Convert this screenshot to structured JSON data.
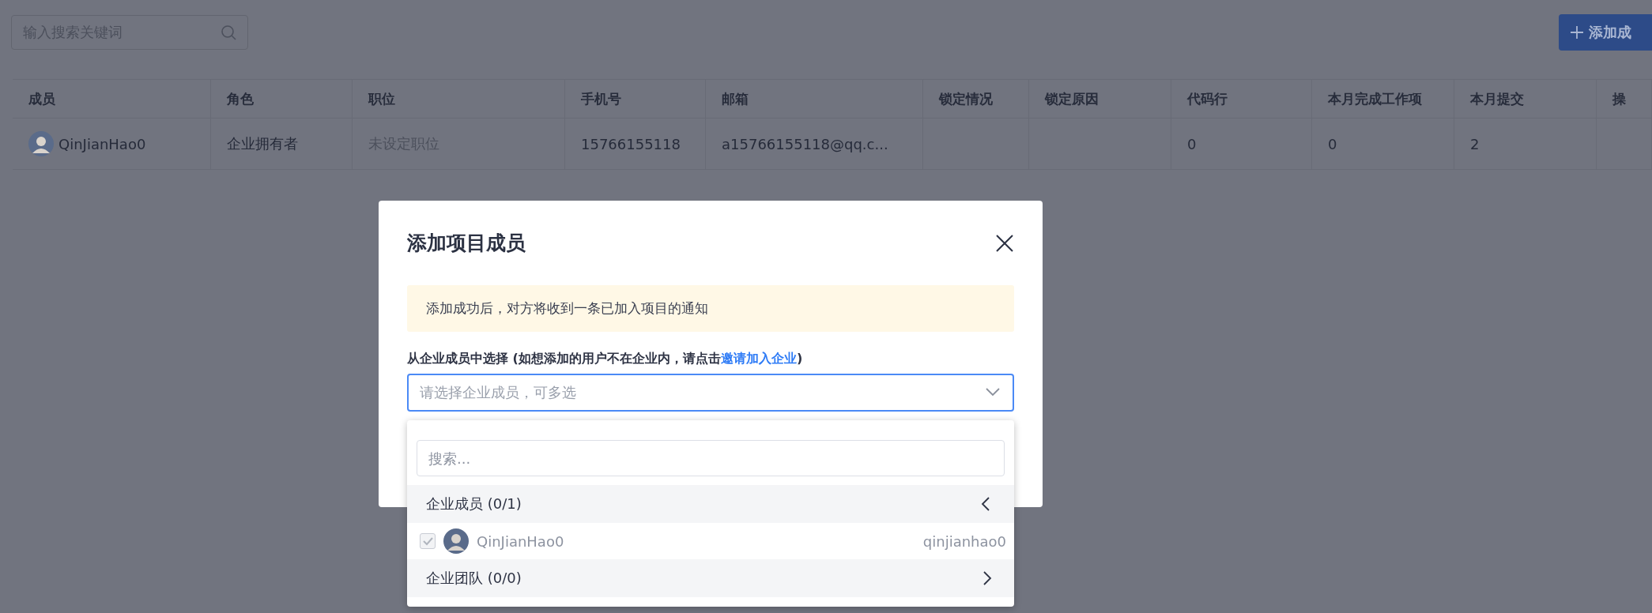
{
  "search": {
    "placeholder": "输入搜索关键词"
  },
  "add_button": {
    "label": "添加成"
  },
  "table": {
    "columns": [
      "成员",
      "角色",
      "职位",
      "手机号",
      "邮箱",
      "锁定情况",
      "锁定原因",
      "代码行",
      "本月完成工作项",
      "本月提交",
      "操"
    ],
    "rows": [
      {
        "cells": [
          {
            "text": "QinJianHao0",
            "kind": "member",
            "muted": false
          },
          {
            "text": "企业拥有者",
            "kind": "text",
            "muted": false
          },
          {
            "text": "未设定职位",
            "kind": "text",
            "muted": true
          },
          {
            "text": "15766155118",
            "kind": "text",
            "muted": false
          },
          {
            "text": "a15766155118@qq.c...",
            "kind": "text",
            "muted": false
          },
          null,
          null,
          {
            "text": "0",
            "kind": "text",
            "muted": false
          },
          {
            "text": "0",
            "kind": "text",
            "muted": false
          },
          {
            "text": "2",
            "kind": "text",
            "muted": false
          },
          null
        ]
      }
    ]
  },
  "dialog": {
    "title": "添加项目成员",
    "notice": "添加成功后，对方将收到一条已加入项目的通知",
    "label": {
      "text": "从企业成员中选择 (如想添加的用户不在企业内，请点击",
      "link": "邀请加入企业",
      "after": ")"
    },
    "select": {
      "placeholder": "请选择企业成员，可多选",
      "focused": true
    },
    "dropdown": {
      "search_placeholder": "搜索...",
      "groups": [
        {
          "label": "企业成员 (0/1)",
          "expanded": true,
          "members": [
            {
              "name": "QinJianHao0",
              "username": "qinjianhao0",
              "checked": true,
              "disabled": true
            }
          ]
        },
        {
          "label": "企业团队 (0/0)",
          "expanded": false
        }
      ]
    }
  }
}
